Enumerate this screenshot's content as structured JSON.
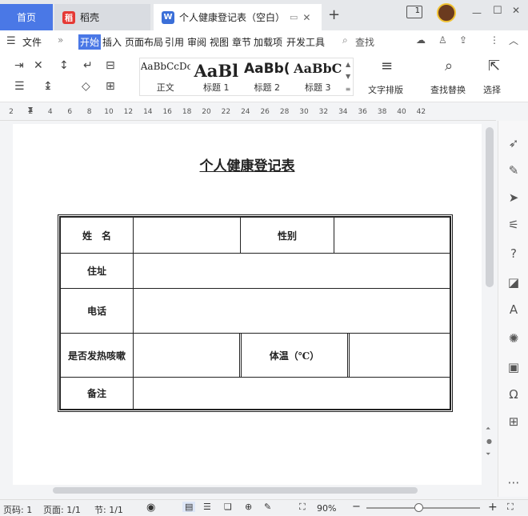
{
  "tabs": {
    "home": "首页",
    "daoke": "稻壳",
    "doc": "个人健康登记表（空白）"
  },
  "window": {
    "badge": "1"
  },
  "menu": {
    "file": "文件",
    "items": [
      "开始",
      "插入",
      "页面布局",
      "引用",
      "审阅",
      "视图",
      "章节",
      "加载项",
      "开发工具"
    ],
    "search": "查找"
  },
  "styles": [
    {
      "sample": "AaBbCcDc",
      "label": "正文"
    },
    {
      "sample": "AaBl",
      "label": "标题 1"
    },
    {
      "sample": "AaBb(",
      "label": "标题 2"
    },
    {
      "sample": "AaBbC",
      "label": "标题 3"
    }
  ],
  "ribbon": {
    "text_layout": "文字排版",
    "find_replace": "查找替换",
    "select": "选择"
  },
  "ruler": [
    "2",
    "2",
    "4",
    "6",
    "8",
    "10",
    "12",
    "14",
    "16",
    "18",
    "20",
    "22",
    "24",
    "26",
    "28",
    "30",
    "32",
    "34",
    "36",
    "38",
    "40",
    "42"
  ],
  "document": {
    "title": "个人健康登记表",
    "form": {
      "name": "姓　名",
      "gender": "性别",
      "address": "住址",
      "phone": "电话",
      "fever": "是否发热咳嗽",
      "temp": "体温（℃）",
      "notes": "备注"
    }
  },
  "status": {
    "page_num": "页码: 1",
    "pages": "页面: 1/1",
    "section": "节: 1/1",
    "zoom": "90%"
  },
  "colors": {
    "accent": "#4a78e6",
    "active_menu": "#4a78e6"
  }
}
